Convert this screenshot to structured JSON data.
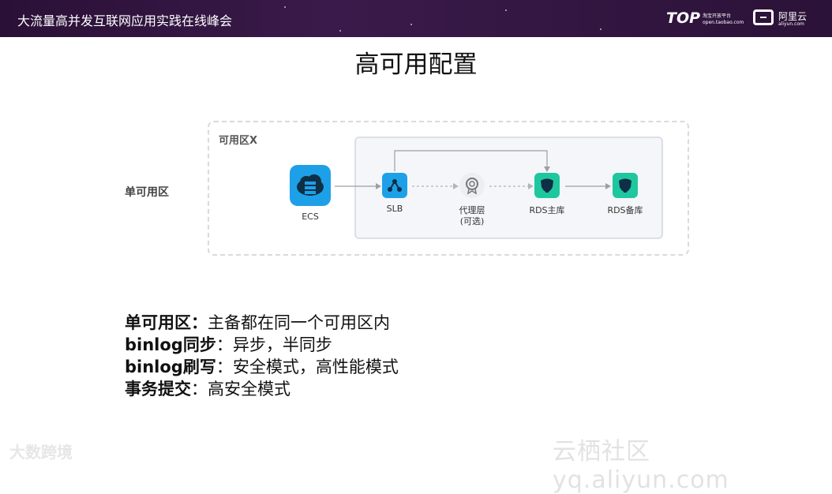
{
  "header": {
    "title": "大流量高并发互联网应用实践在线峰会",
    "top_logo": "TOP",
    "top_logo_sub1": "淘宝开放平台",
    "top_logo_sub2": "open.taobao.com",
    "aliyun_logo": "阿里云",
    "aliyun_logo_sub": "aliyun.com"
  },
  "slide": {
    "title": "高可用配置"
  },
  "diagram": {
    "zone_label": "可用区X",
    "side_label": "单可用区",
    "nodes": [
      {
        "label": "ECS",
        "icon": "cloud-server-icon"
      },
      {
        "label": "SLB",
        "icon": "load-balancer-icon"
      },
      {
        "label": "代理层",
        "label2": "(可选)",
        "icon": "badge-icon"
      },
      {
        "label": "RDS主库",
        "icon": "database-elephant-icon"
      },
      {
        "label": "RDS备库",
        "icon": "database-elephant-icon"
      }
    ]
  },
  "summary": [
    {
      "key": "单可用区：",
      "value": "主备都在同一个可用区内"
    },
    {
      "key": "binlog同步",
      "value": "：异步，半同步"
    },
    {
      "key": "binlog刷写",
      "value": "：安全模式，高性能模式"
    },
    {
      "key": "事务提交",
      "value": "：高安全模式"
    }
  ],
  "watermarks": {
    "left": "大数跨境",
    "right": "云栖社区 yq.aliyun.com"
  },
  "colors": {
    "header_bg": "#2a1036",
    "accent_blue": "#1ea0e8",
    "accent_green": "#1fc79e"
  }
}
